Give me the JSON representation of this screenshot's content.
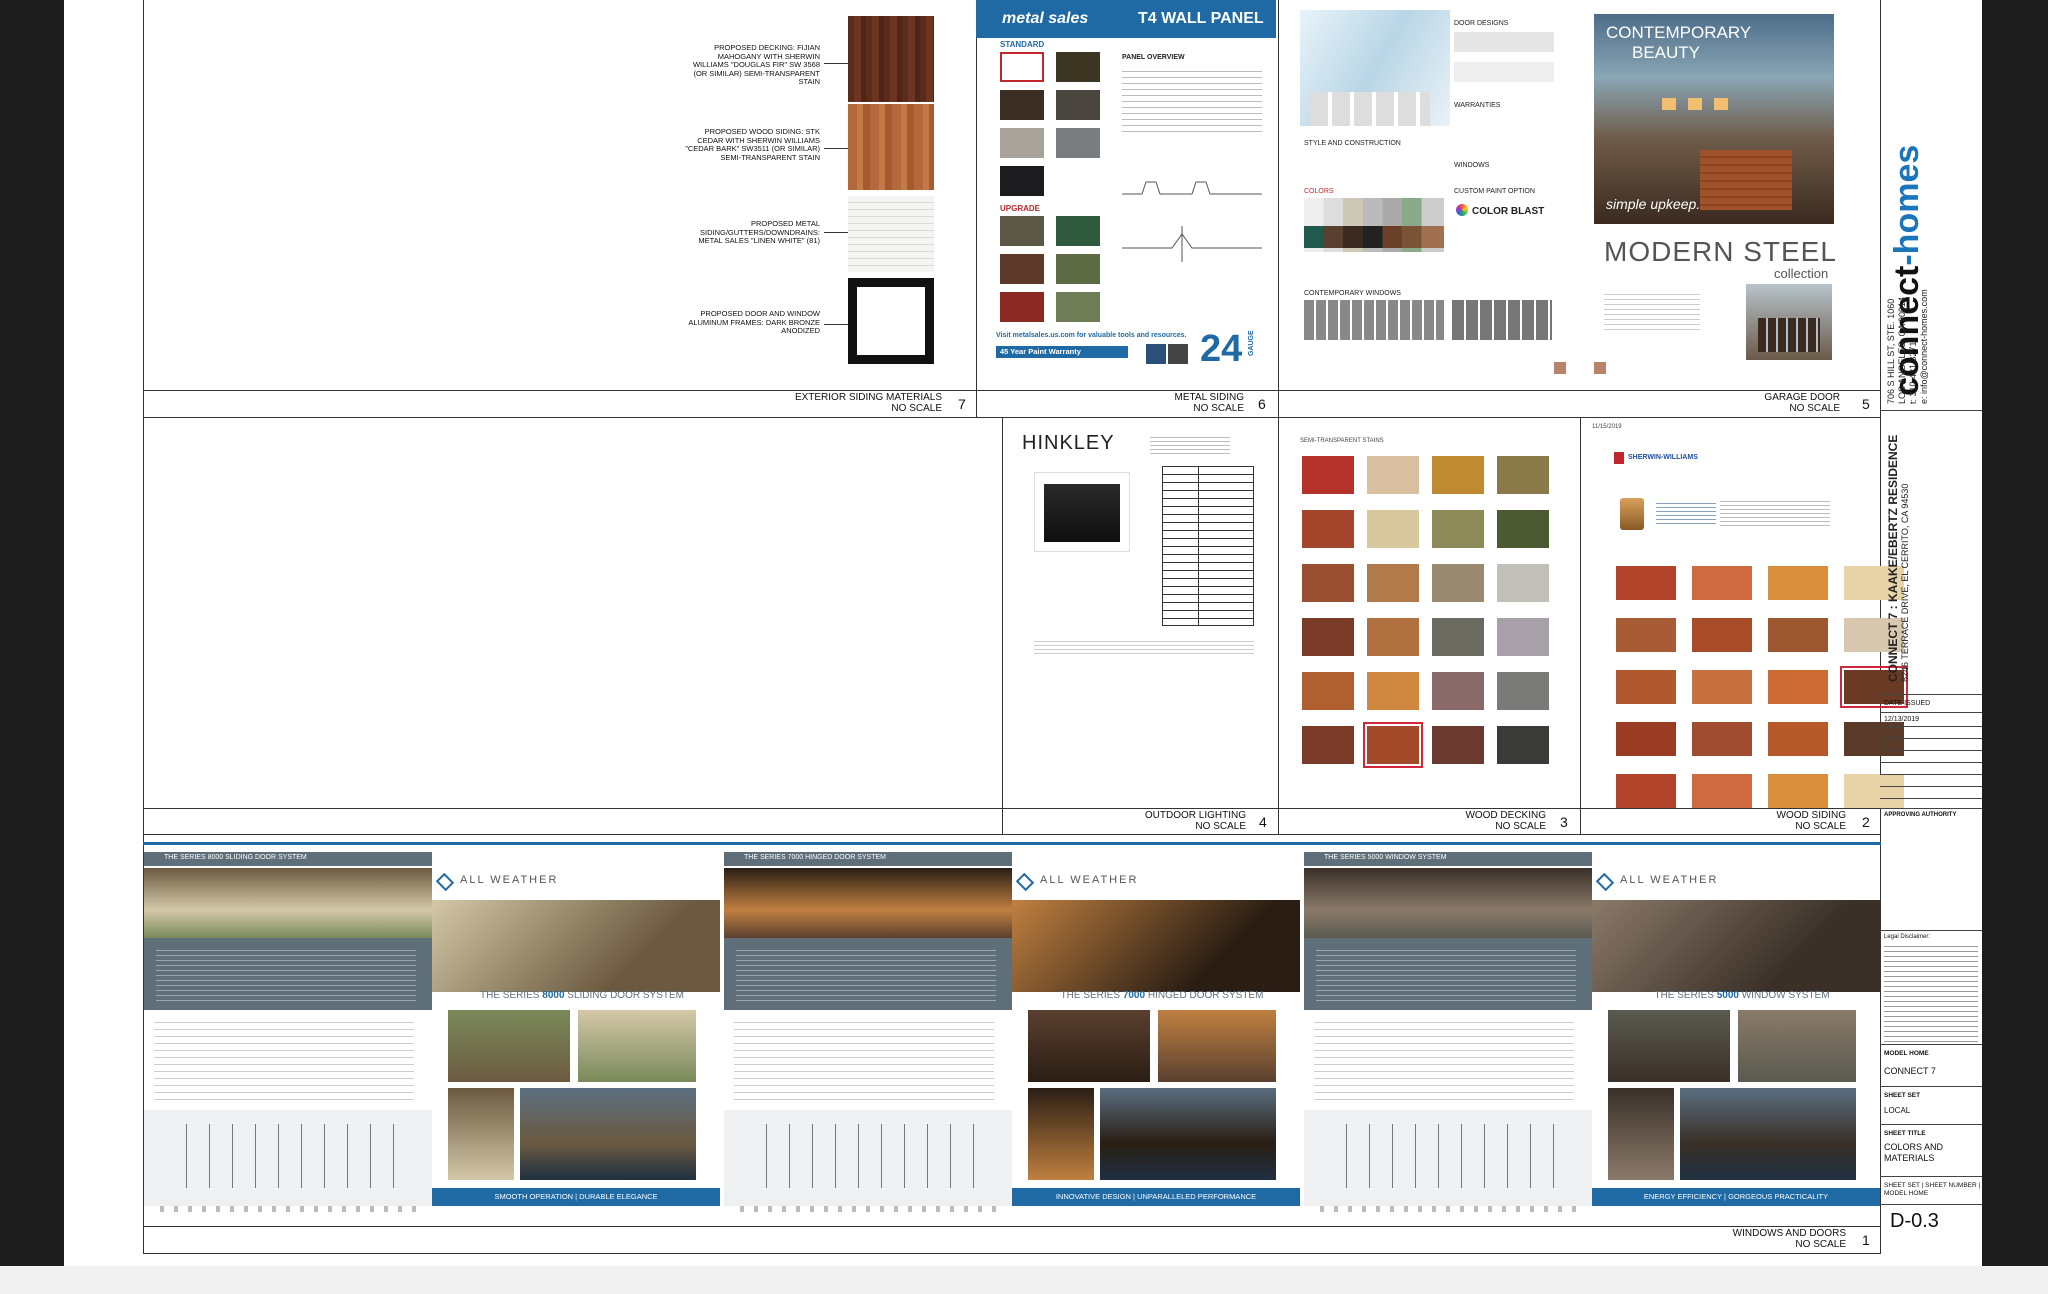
{
  "panels": {
    "p7": {
      "title": "EXTERIOR SIDING MATERIALS",
      "scale": "NO SCALE",
      "number": "7",
      "labels": [
        "PROPOSED DECKING: FIJIAN MAHOGANY WITH SHERWIN WILLIAMS \"DOUGLAS FIR\" SW 3568 (OR SIMILAR) SEMI-TRANSPARENT STAIN",
        "PROPOSED WOOD SIDING: STK CEDAR WITH SHERWIN WILLIAMS \"CEDAR BARK\" SW3511 (OR SIMILAR) SEMI-TRANSPARENT STAIN",
        "PROPOSED METAL SIDING/GUTTERS/DOWNDRAINS: METAL SALES \"LINEN WHITE\" (81)",
        "PROPOSED DOOR AND WINDOW ALUMINUM FRAMES: DARK BRONZE ANODIZED"
      ]
    },
    "p6": {
      "title": "METAL SIDING",
      "scale": "NO SCALE",
      "number": "6",
      "brand": "metal sales",
      "product": "T4 WALL PANEL",
      "standard": "STANDARD",
      "upgrade": "UPGRADE",
      "overview": "PANEL OVERVIEW",
      "warranty": "45 Year Paint Warranty",
      "gauge": "24",
      "gauge_label": "GAUGE",
      "visit": "Visit metalsales.us.com for valuable tools and resources."
    },
    "p5": {
      "title": "GARAGE DOOR",
      "scale": "NO SCALE",
      "number": "5",
      "hero_line1": "CONTEMPORARY",
      "hero_line2": "BEAUTY",
      "hero_tag": "simple upkeep.",
      "collection_title": "MODERN STEEL",
      "collection_sub": "collection",
      "door_designs": "DOOR DESIGNS",
      "warranties": "WARRANTIES",
      "style": "STYLE AND CONSTRUCTION",
      "windows": "WINDOWS",
      "custom_paint": "CUSTOM PAINT OPTION",
      "color_blast": "COLOR BLAST",
      "colors": "COLORS",
      "contemporary_windows": "CONTEMPORARY WINDOWS"
    },
    "p4": {
      "title": "OUTDOOR LIGHTING",
      "scale": "NO SCALE",
      "number": "4",
      "brand": "HINKLEY"
    },
    "p3": {
      "title": "WOOD DECKING",
      "scale": "NO SCALE",
      "number": "3",
      "heading": "SEMI-TRANSPARENT STAINS"
    },
    "p2": {
      "title": "WOOD SIDING",
      "scale": "NO SCALE",
      "number": "2",
      "brand": "SHERWIN-WILLIAMS",
      "date": "11/15/2019"
    },
    "p1": {
      "title": "WINDOWS AND DOORS",
      "scale": "NO SCALE",
      "number": "1",
      "brand": "ALL WEATHER",
      "series": [
        {
          "header": "THE SERIES 8000 SLIDING DOOR SYSTEM",
          "name_pre": "THE SERIES ",
          "name_num": "8000",
          "name_post": " SLIDING DOOR SYSTEM",
          "footer": "SMOOTH OPERATION | DURABLE ELEGANCE"
        },
        {
          "header": "THE SERIES 7000 HINGED DOOR SYSTEM",
          "name_pre": "THE SERIES ",
          "name_num": "7000",
          "name_post": " HINGED DOOR SYSTEM",
          "footer": "INNOVATIVE DESIGN | UNPARALLELED PERFORMANCE"
        },
        {
          "header": "THE SERIES 5000 WINDOW SYSTEM",
          "name_pre": "THE SERIES ",
          "name_num": "5000",
          "name_post": " WINDOW SYSTEM",
          "footer": "ENERGY EFFICIENCY | GORGEOUS PRACTICALITY"
        }
      ]
    }
  },
  "titleblock": {
    "logo_a": "connect",
    "logo_b": "-homes",
    "address": [
      "706 S HILL ST, STE. 1060",
      "LOS ANGELES, CA 90014",
      "t: 310.421.3271",
      "e: info@connect-homes.com"
    ],
    "project": "CONNECT 7 : KAAKE/EBERTZ RESIDENCE",
    "project_address": "8246 TERRACE DRIVE, EL CERRITO, CA 94530",
    "date_issued_label": "DATE ISSUED",
    "date_issued": "12/13/2019",
    "approving": "APPROVING AUTHORITY",
    "disclaimer_title": "Legal Disclaimer:",
    "model_home_label": "MODEL HOME",
    "model_home": "CONNECT 7",
    "sheet_set_label": "SHEET SET",
    "sheet_set": "LOCAL",
    "sheet_title_label": "SHEET TITLE",
    "sheet_title": "COLORS AND MATERIALS",
    "legend": "SHEET SET | SHEET NUMBER | MODEL HOME",
    "sheet_number": "D-0.3"
  },
  "colors": {
    "blue": "#1f6aa5",
    "metal_red": "#c0272d",
    "cedar": "#b5683c",
    "connect_blue": "#1b75bb"
  }
}
